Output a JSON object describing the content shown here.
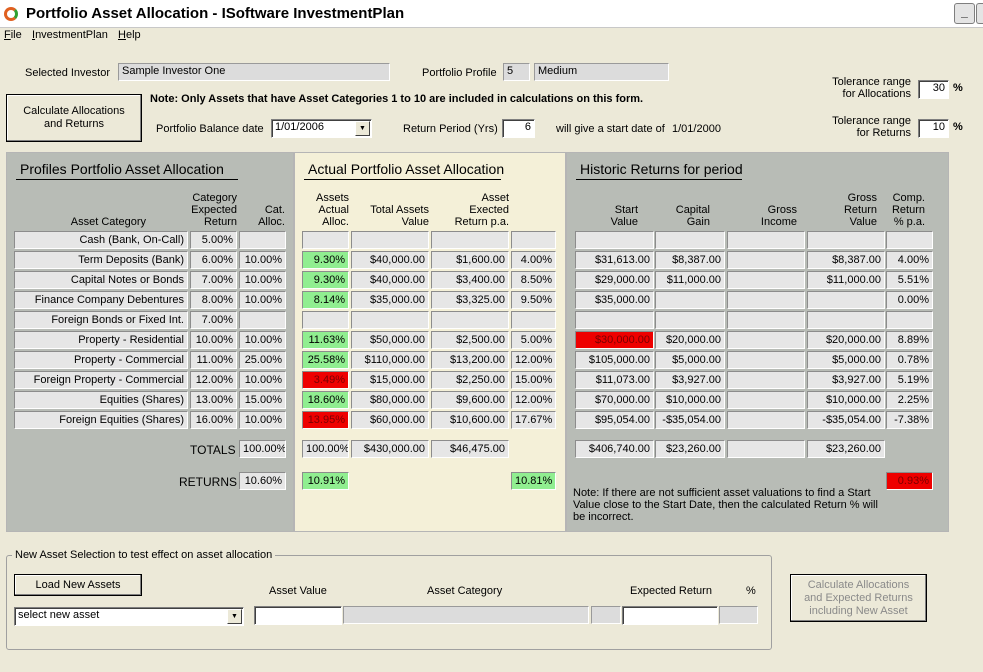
{
  "window": {
    "title": "Portfolio Asset Allocation - ISoftware InvestmentPlan",
    "minimize": "_",
    "close": "×"
  },
  "menu": [
    "File",
    "InvestmentPlan",
    "Help"
  ],
  "header": {
    "selected_investor_label": "Selected Investor",
    "selected_investor_value": "Sample Investor One",
    "portfolio_profile_label": "Portfolio Profile",
    "portfolio_profile_num": "5",
    "portfolio_profile_name": "Medium",
    "tolerance_alloc_label": "Tolerance range\nfor Allocations",
    "tolerance_alloc_value": "30",
    "tolerance_returns_label": "Tolerance range\nfor Returns",
    "tolerance_returns_value": "10",
    "percent": "%",
    "calc_button": "Calculate Allocations\nand Returns",
    "note": "Note: Only Assets that have Asset Categories 1 to 10 are included in calculations on this form.",
    "balance_date_label": "Portfolio Balance date",
    "balance_date_value": "1/01/2006",
    "return_period_label": "Return Period (Yrs)",
    "return_period_value": "6",
    "start_date_text": "will give a start date of",
    "start_date_value": "1/01/2000"
  },
  "profiles_panel": {
    "title": "Profiles Portfolio Asset Allocation",
    "col_category": "Asset Category",
    "col_expected": "Category\nExpected\nReturn",
    "col_alloc": "Cat.\nAlloc.",
    "rows": [
      {
        "category": "Cash (Bank, On-Call)",
        "expected": "5.00%",
        "alloc": ""
      },
      {
        "category": "Term Deposits (Bank)",
        "expected": "6.00%",
        "alloc": "10.00%"
      },
      {
        "category": "Capital Notes or Bonds",
        "expected": "7.00%",
        "alloc": "10.00%"
      },
      {
        "category": "Finance Company Debentures",
        "expected": "8.00%",
        "alloc": "10.00%"
      },
      {
        "category": "Foreign Bonds or Fixed Int.",
        "expected": "7.00%",
        "alloc": ""
      },
      {
        "category": "Property - Residential",
        "expected": "10.00%",
        "alloc": "10.00%"
      },
      {
        "category": "Property - Commercial",
        "expected": "11.00%",
        "alloc": "25.00%"
      },
      {
        "category": "Foreign Property - Commercial",
        "expected": "12.00%",
        "alloc": "10.00%"
      },
      {
        "category": "Equities (Shares)",
        "expected": "13.00%",
        "alloc": "15.00%"
      },
      {
        "category": "Foreign Equities (Shares)",
        "expected": "16.00%",
        "alloc": "10.00%"
      }
    ],
    "totals_label": "TOTALS",
    "totals_value": "100.00%",
    "returns_label": "RETURNS",
    "returns_value": "10.60%"
  },
  "actual_panel": {
    "title": "Actual Portfolio Asset Allocation",
    "col_alloc": "Assets\nActual\nAlloc.",
    "col_value": "Total Assets\nValue",
    "col_return": "Asset\nExected\nReturn p.a.",
    "rows": [
      {
        "alloc": "",
        "value": "",
        "return": "",
        "pct": "",
        "status": "none"
      },
      {
        "alloc": "9.30%",
        "value": "$40,000.00",
        "return": "$1,600.00",
        "pct": "4.00%",
        "status": "ok"
      },
      {
        "alloc": "9.30%",
        "value": "$40,000.00",
        "return": "$3,400.00",
        "pct": "8.50%",
        "status": "ok"
      },
      {
        "alloc": "8.14%",
        "value": "$35,000.00",
        "return": "$3,325.00",
        "pct": "9.50%",
        "status": "ok"
      },
      {
        "alloc": "",
        "value": "",
        "return": "",
        "pct": "",
        "status": "none"
      },
      {
        "alloc": "11.63%",
        "value": "$50,000.00",
        "return": "$2,500.00",
        "pct": "5.00%",
        "status": "ok"
      },
      {
        "alloc": "25.58%",
        "value": "$110,000.00",
        "return": "$13,200.00",
        "pct": "12.00%",
        "status": "ok"
      },
      {
        "alloc": "3.49%",
        "value": "$15,000.00",
        "return": "$2,250.00",
        "pct": "15.00%",
        "status": "out"
      },
      {
        "alloc": "18.60%",
        "value": "$80,000.00",
        "return": "$9,600.00",
        "pct": "12.00%",
        "status": "ok"
      },
      {
        "alloc": "13.95%",
        "value": "$60,000.00",
        "return": "$10,600.00",
        "pct": "17.67%",
        "status": "out"
      }
    ],
    "totals_alloc": "100.00%",
    "totals_value": "$430,000.00",
    "totals_return": "$46,475.00",
    "returns_alloc": "10.91%",
    "returns_pct": "10.81%"
  },
  "historic_panel": {
    "title": "Historic Returns for period",
    "col_start": "Start\nValue",
    "col_gain": "Capital\nGain",
    "col_income": "Gross\nIncome",
    "col_gross": "Gross\nReturn\nValue",
    "col_comp": "Comp.\nReturn\n% p.a.",
    "rows": [
      {
        "start": "",
        "gain": "",
        "income": "",
        "gross": "",
        "comp": "",
        "start_status": "none"
      },
      {
        "start": "$31,613.00",
        "gain": "$8,387.00",
        "income": "",
        "gross": "$8,387.00",
        "comp": "4.00%",
        "start_status": "none"
      },
      {
        "start": "$29,000.00",
        "gain": "$11,000.00",
        "income": "",
        "gross": "$11,000.00",
        "comp": "5.51%",
        "start_status": "none"
      },
      {
        "start": "$35,000.00",
        "gain": "",
        "income": "",
        "gross": "",
        "comp": "0.00%",
        "start_status": "none"
      },
      {
        "start": "",
        "gain": "",
        "income": "",
        "gross": "",
        "comp": "",
        "start_status": "none"
      },
      {
        "start": "$30,000.00",
        "gain": "$20,000.00",
        "income": "",
        "gross": "$20,000.00",
        "comp": "8.89%",
        "start_status": "out"
      },
      {
        "start": "$105,000.00",
        "gain": "$5,000.00",
        "income": "",
        "gross": "$5,000.00",
        "comp": "0.78%",
        "start_status": "none"
      },
      {
        "start": "$11,073.00",
        "gain": "$3,927.00",
        "income": "",
        "gross": "$3,927.00",
        "comp": "5.19%",
        "start_status": "none"
      },
      {
        "start": "$70,000.00",
        "gain": "$10,000.00",
        "income": "",
        "gross": "$10,000.00",
        "comp": "2.25%",
        "start_status": "none"
      },
      {
        "start": "$95,054.00",
        "gain": "-$35,054.00",
        "income": "",
        "gross": "-$35,054.00",
        "comp": "-7.38%",
        "start_status": "none"
      }
    ],
    "totals_start": "$406,740.00",
    "totals_gain": "$23,260.00",
    "totals_income": "",
    "totals_gross": "$23,260.00",
    "returns_comp": "0.93%",
    "note": "Note: If there are not sufficient asset valuations to find a Start Value close to the Start Date, then the calculated Return % will be incorrect."
  },
  "new_asset": {
    "group_title": "New Asset Selection to test effect on asset allocation",
    "load_button": "Load New Assets",
    "select_value": "select new asset",
    "asset_value_label": "Asset Value",
    "asset_category_label": "Asset Category",
    "expected_return_label": "Expected Return",
    "percent_label": "%",
    "calc_button": "Calculate Allocations\nand Expected Returns\nincluding New Asset"
  },
  "colors": {
    "green": "#90ee90",
    "red": "#ee0000",
    "panel_grey": "#b8bcb6",
    "panel_cream": "#f4f0d8"
  }
}
